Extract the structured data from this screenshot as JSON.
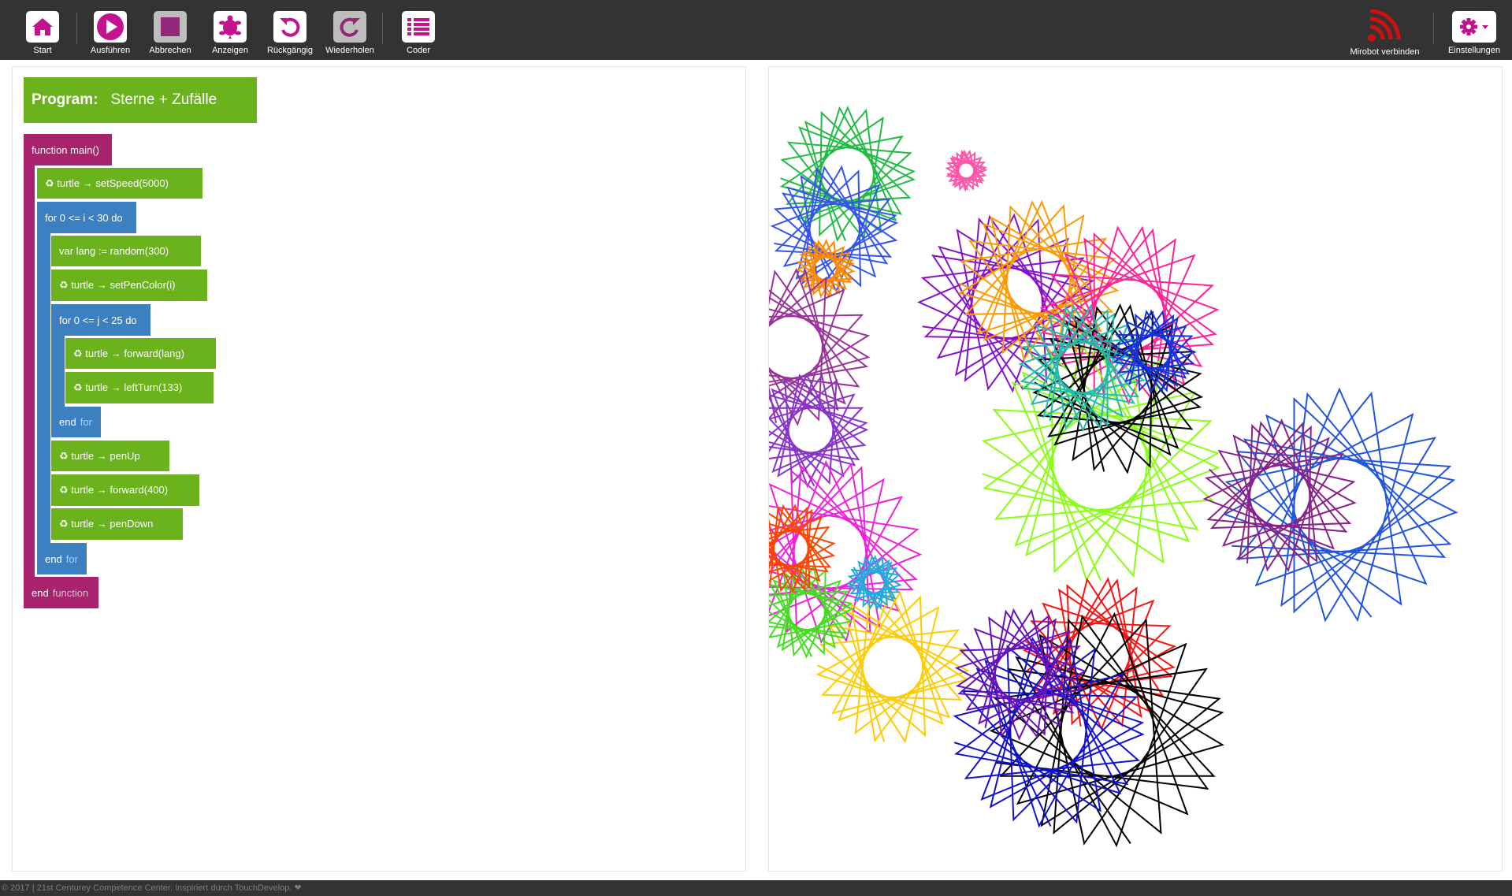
{
  "toolbar": {
    "items": [
      {
        "label": "Start",
        "icon": "home-icon"
      },
      {
        "label": "Ausführen",
        "icon": "play-icon"
      },
      {
        "label": "Abbrechen",
        "icon": "stop-icon"
      },
      {
        "label": "Anzeigen",
        "icon": "turtle-icon"
      },
      {
        "label": "Rückgängig",
        "icon": "undo-icon"
      },
      {
        "label": "Wiederholen",
        "icon": "redo-icon"
      },
      {
        "label": "Coder",
        "icon": "list-icon"
      }
    ],
    "mirobot_label": "Mirobot verbinden",
    "settings_label": "Einstellungen"
  },
  "program": {
    "label": "Program:",
    "name": "Sterne + Zufälle"
  },
  "code": {
    "function_main": "function main()",
    "set_speed": "♻ turtle → setSpeed(5000)",
    "for_i": "for 0 <= i < 30 do",
    "var_lang": "var lang := random(300)",
    "set_pen_color": "♻ turtle → setPenColor(i)",
    "for_j": "for 0 <= j < 25 do",
    "forward_lang": "♻ turtle → forward(lang)",
    "left_turn": "♻ turtle → leftTurn(133)",
    "end_kw": "end",
    "for_kw": "for",
    "pen_up": "♻ turtle → penUp",
    "forward_400": "♻ turtle → forward(400)",
    "pen_down": "♻ turtle → penDown",
    "function_kw": "function"
  },
  "footer": {
    "text": "© 2017 | 21st Centurey Competence Center. Inspiriert durch TouchDevelop. ❤"
  },
  "colors": {
    "toolbar_bg": "#333333",
    "accent_magenta": "#c2138f",
    "function_block": "#a8226d",
    "loop_block": "#3d80c1",
    "statement_block": "#6ab31d",
    "mirobot_red": "#cc1111"
  }
}
